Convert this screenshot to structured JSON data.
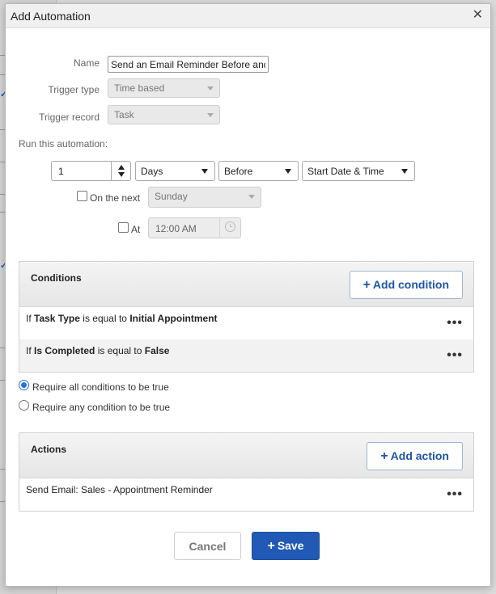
{
  "modal": {
    "title": "Add Automation",
    "close_icon": "close-icon"
  },
  "form": {
    "name_label": "Name",
    "name_value": "Send an Email Reminder Before and",
    "trigger_type_label": "Trigger type",
    "trigger_type_value": "Time based",
    "trigger_record_label": "Trigger record",
    "trigger_record_value": "Task",
    "run_label": "Run this automation:",
    "run_amount": "1",
    "unit_value": "Days",
    "relation_value": "Before",
    "field_value": "Start Date & Time",
    "on_next_label": "On the next",
    "on_next_value": "Sunday",
    "at_label": "At",
    "time_value": "12:00 AM"
  },
  "conditions": {
    "title": "Conditions",
    "add_label": "Add condition",
    "rows": [
      {
        "prefix": "If",
        "field": "Task Type",
        "op": "is equal to",
        "value": "Initial Appointment"
      },
      {
        "prefix": "If",
        "field": "Is Completed",
        "op": "is equal to",
        "value": "False"
      }
    ],
    "require_all": "Require all conditions to be true",
    "require_any": "Require any condition to be true",
    "selected": "all"
  },
  "actions": {
    "title": "Actions",
    "add_label": "Add action",
    "rows": [
      {
        "text": "Send Email: Sales - Appointment Reminder"
      }
    ]
  },
  "footer": {
    "cancel_label": "Cancel",
    "save_label": "Save"
  },
  "colors": {
    "primary": "#2159b4",
    "link": "#1f54a8"
  }
}
